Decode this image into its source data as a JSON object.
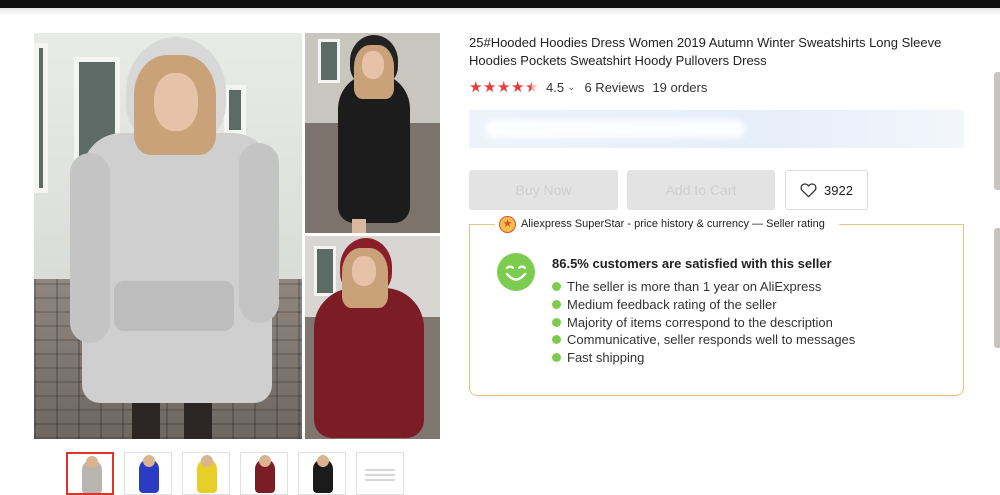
{
  "product": {
    "title": "25#Hooded Hoodies Dress Women 2019 Autumn Winter Sweatshirts Long Sleeve Hoodies Pockets Sweatshirt Hoody Pullovers Dress",
    "rating": "4.5",
    "rating_stars": 4.5,
    "reviews": "6 Reviews",
    "orders": "19 orders"
  },
  "actions": {
    "buy_now": "Buy Now",
    "add_to_cart": "Add to Cart",
    "wishlist_count": "3922"
  },
  "extension": {
    "header": "Aliexpress SuperStar - price history & currency — Seller rating",
    "satisfaction": "86.5% customers are satisfied with this seller",
    "points": [
      "The seller is more than 1 year on AliExpress",
      "Medium feedback rating of the seller",
      "Majority of items correspond to the description",
      "Communicative, seller responds well to messages",
      "Fast shipping"
    ]
  },
  "thumbnails": [
    {
      "color": "#b9b6b2",
      "selected": true
    },
    {
      "color": "#2a3cc4",
      "selected": false
    },
    {
      "color": "#e7cf2a",
      "selected": false
    },
    {
      "color": "#7c1c24",
      "selected": false
    },
    {
      "color": "#1b1b1b",
      "selected": false
    },
    {
      "color": "#d0d0d0",
      "selected": false
    }
  ],
  "colors": {
    "star": "#e93b3b",
    "accent_border": "#e8c27c",
    "positive": "#7ccd4f",
    "selected_thumb": "#e0332d"
  }
}
